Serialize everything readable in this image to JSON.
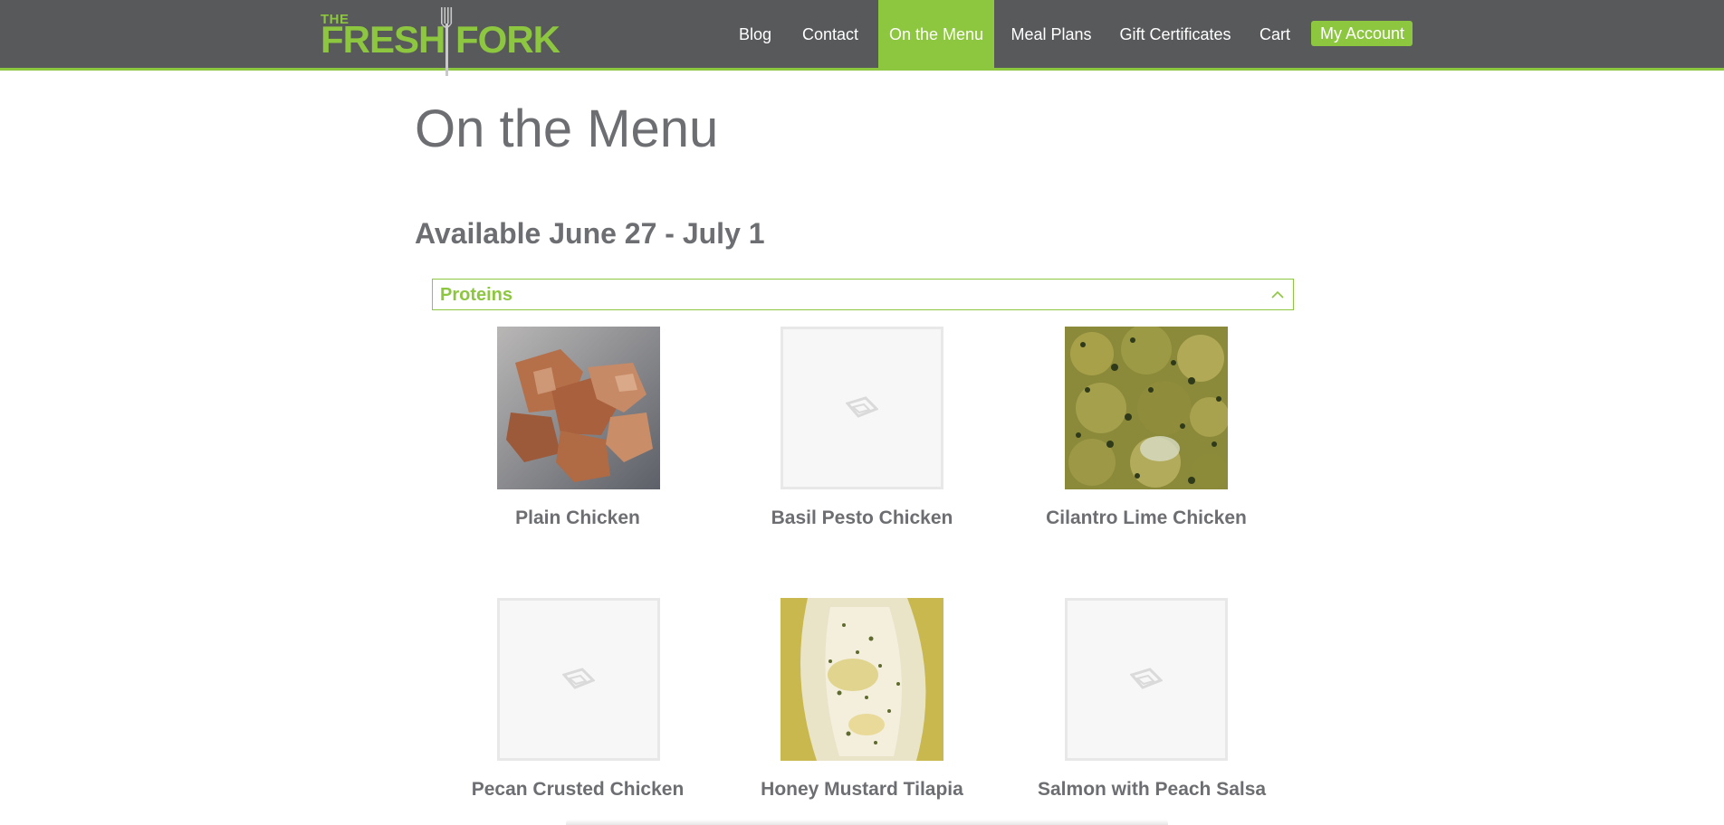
{
  "logo": {
    "the": "THE",
    "fresh": "FRESH",
    "fork": "FORK"
  },
  "nav": {
    "items": [
      {
        "label": "Blog"
      },
      {
        "label": "Contact"
      },
      {
        "label": "On the Menu"
      },
      {
        "label": "Meal Plans"
      },
      {
        "label": "Gift Certificates"
      },
      {
        "label": "Cart"
      }
    ],
    "account_label": "My Account"
  },
  "page": {
    "title": "On the Menu",
    "section_title": "Available June 27 - July 1"
  },
  "accordion": {
    "label": "Proteins",
    "icon": "chevron-up-icon",
    "expanded": true
  },
  "menu_items": [
    {
      "name": "Plain Chicken",
      "image": "photo"
    },
    {
      "name": "Basil Pesto Chicken",
      "image": "placeholder"
    },
    {
      "name": "Cilantro Lime Chicken",
      "image": "photo"
    },
    {
      "name": "Pecan Crusted Chicken",
      "image": "placeholder"
    },
    {
      "name": "Honey Mustard Tilapia",
      "image": "photo"
    },
    {
      "name": "Salmon with Peach Salsa",
      "image": "placeholder"
    }
  ],
  "colors": {
    "brand_green": "#8dc63f",
    "header_gray": "#58595b",
    "text_gray": "#6d6e71"
  }
}
